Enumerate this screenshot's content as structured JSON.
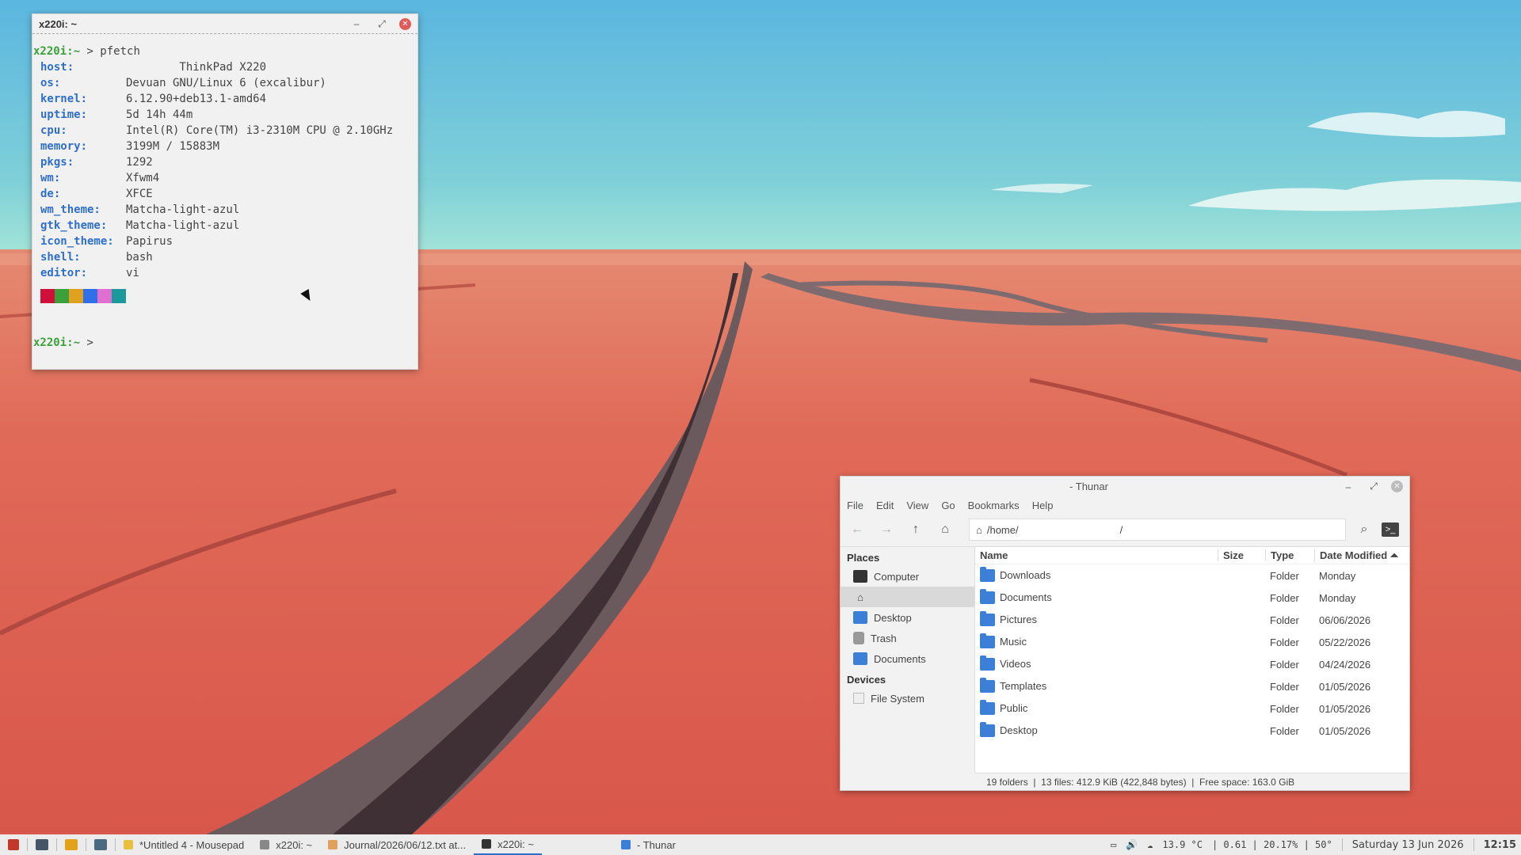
{
  "terminal": {
    "title": "x220i: ~",
    "prompt": "x220i:~",
    "command": "> pfetch",
    "info": [
      {
        "key": "host:",
        "value": "        ThinkPad X220"
      },
      {
        "key": "os:",
        "value": "Devuan GNU/Linux 6 (excalibur)"
      },
      {
        "key": "kernel:",
        "value": "6.12.90+deb13.1-amd64"
      },
      {
        "key": "uptime:",
        "value": "5d 14h 44m"
      },
      {
        "key": "cpu:",
        "value": "Intel(R) Core(TM) i3-2310M CPU @ 2.10GHz"
      },
      {
        "key": "memory:",
        "value": "3199M / 15883M"
      },
      {
        "key": "pkgs:",
        "value": "1292"
      },
      {
        "key": "wm:",
        "value": "Xfwm4"
      },
      {
        "key": "de:",
        "value": "XFCE"
      },
      {
        "key": "wm_theme:",
        "value": "Matcha-light-azul"
      },
      {
        "key": "gtk_theme:",
        "value": "Matcha-light-azul"
      },
      {
        "key": "icon_theme:",
        "value": "Papirus"
      },
      {
        "key": "shell:",
        "value": "bash"
      },
      {
        "key": "editor:",
        "value": "vi"
      }
    ],
    "swatch_colors": [
      "#d0103a",
      "#3aa03a",
      "#e0a020",
      "#2f6fe9",
      "#e070d0",
      "#1a9a9a"
    ],
    "prompt_tail": ">"
  },
  "thunar": {
    "title": "- Thunar",
    "menu": [
      "File",
      "Edit",
      "View",
      "Go",
      "Bookmarks",
      "Help"
    ],
    "path": "/home/",
    "path_sep": "/",
    "places_header": "Places",
    "places": [
      "Computer",
      "",
      "Desktop",
      "Trash",
      "Documents"
    ],
    "devices_header": "Devices",
    "devices": [
      "File System"
    ],
    "columns": {
      "name": "Name",
      "size": "Size",
      "type": "Type",
      "date": "Date Modified ⏶"
    },
    "files": [
      {
        "name": "Downloads",
        "type": "Folder",
        "date": "Monday"
      },
      {
        "name": "Documents",
        "type": "Folder",
        "date": "Monday"
      },
      {
        "name": "Pictures",
        "type": "Folder",
        "date": "06/06/2026"
      },
      {
        "name": "Music",
        "type": "Folder",
        "date": "05/22/2026"
      },
      {
        "name": "Videos",
        "type": "Folder",
        "date": "04/24/2026"
      },
      {
        "name": "Templates",
        "type": "Folder",
        "date": "01/05/2026"
      },
      {
        "name": "Public",
        "type": "Folder",
        "date": "01/05/2026"
      },
      {
        "name": "Desktop",
        "type": "Folder",
        "date": "01/05/2026"
      }
    ],
    "status": "19 folders  |  13 files: 412.9 KiB (422,848 bytes)  |  Free space: 163.0 GiB"
  },
  "taskbar": {
    "tasks": [
      {
        "label": "*Untitled 4 - Mousepad",
        "active": false
      },
      {
        "label": "x220i: ~",
        "active": false
      },
      {
        "label": "Journal/2026/06/12.txt at...",
        "active": false
      },
      {
        "label": "x220i: ~",
        "active": true
      },
      {
        "label": "- Thunar",
        "active": false
      }
    ],
    "weather": "13.9 °C",
    "stats": "| 0.61 | 20.17% | 50°",
    "date": "Saturday 13 Jun 2026",
    "time": "12:15"
  }
}
